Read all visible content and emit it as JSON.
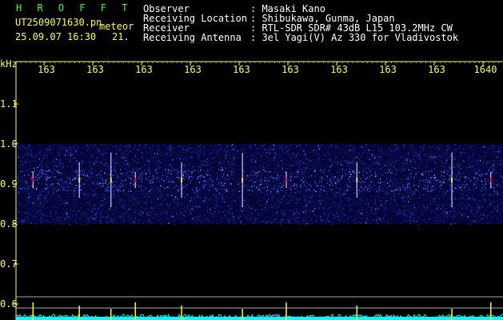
{
  "header": {
    "brand": "H R O F F T",
    "filename": "UT2509071630.pn",
    "mode": "meteor",
    "datetime": "25.09.07 16:30",
    "count": "21.",
    "rows": [
      {
        "label": "Observer",
        "value": ": Masaki Kano"
      },
      {
        "label": "Receiving Location",
        "value": ": Shibukawa, Gunma, Japan"
      },
      {
        "label": "Receiver",
        "value": ": RTL-SDR SDR# 43dB L15 103.2MHz CW"
      },
      {
        "label": "Receiving Antenna",
        "value": ": 3el Yagi(V) Az 330 for Vladivostok"
      }
    ]
  },
  "chart_data": {
    "type": "heatmap",
    "ylabel": "kHz",
    "x_tick_labels": [
      "163",
      "163",
      "163",
      "163",
      "163",
      "163",
      "163",
      "163",
      "163",
      "1640"
    ],
    "y_tick_labels": [
      "1.1",
      "1.0",
      "0.9",
      "0.8",
      "0.7",
      "0.6"
    ],
    "y_ticks": [
      1.1,
      1.0,
      0.9,
      0.8,
      0.7,
      0.6
    ],
    "ylim": [
      0.6,
      1.15
    ],
    "noise_band_khz": [
      0.8,
      1.0
    ],
    "signal_center_khz": 0.91,
    "meteor_echo_positions": [
      0.035,
      0.13,
      0.195,
      0.245,
      0.34,
      0.465,
      0.555,
      0.7,
      0.895,
      0.975
    ],
    "colors": {
      "axis_labels": "#ffff33",
      "title": "#33ff33",
      "noise": "#1010a0",
      "spectrum": "#00ffff",
      "peak": "#ffff00",
      "echo": "#ff0040"
    }
  }
}
